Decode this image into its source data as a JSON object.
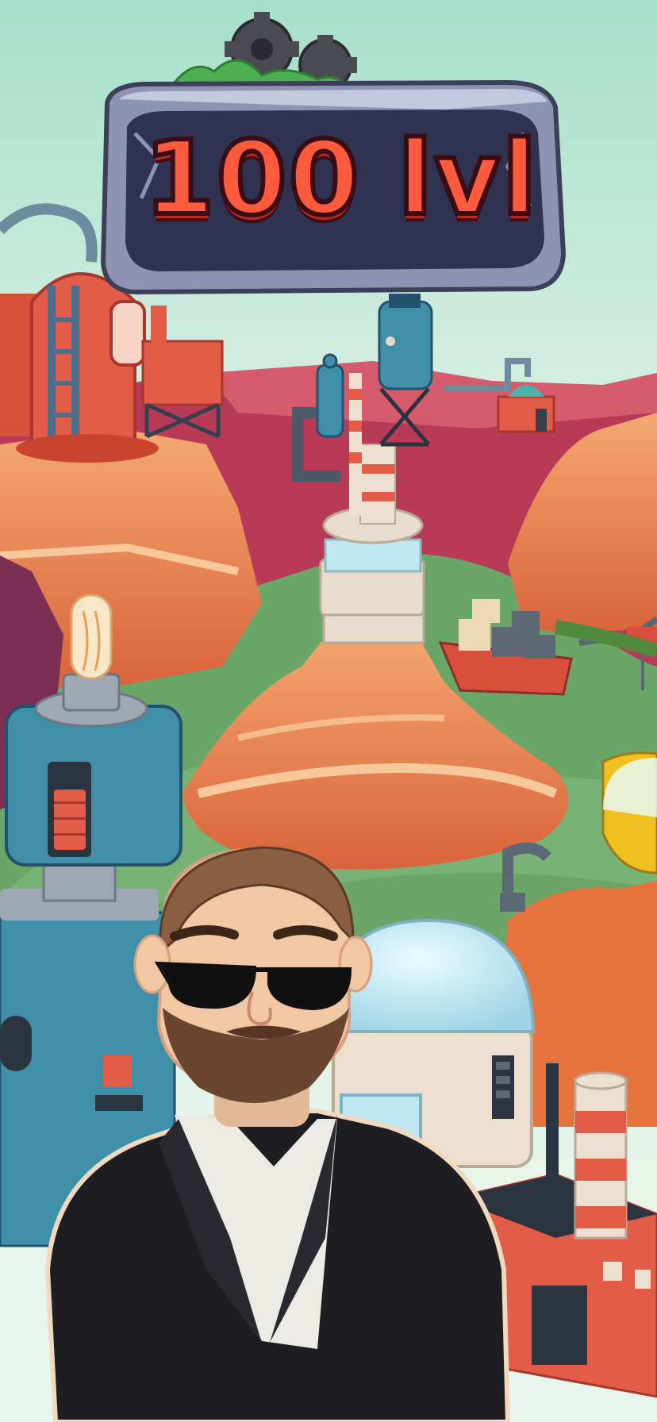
{
  "level_badge": {
    "text": "100 lvl"
  },
  "colors": {
    "sky_top": "#a7dfcb",
    "sky_bottom": "#e8f5ec",
    "badge_stone": "#8f93b3",
    "badge_inner": "#2f3250",
    "badge_text": "#ff5a3c",
    "canyon_orange": "#f07d45",
    "canyon_dark": "#b8412f",
    "water_green": "#6aa668",
    "magenta_rock": "#b93a56",
    "building_red": "#e25c48",
    "tank_blue": "#3f8fa8",
    "suit_black": "#1e1d22"
  },
  "icons": [
    "gear-icon",
    "grass-icon"
  ]
}
